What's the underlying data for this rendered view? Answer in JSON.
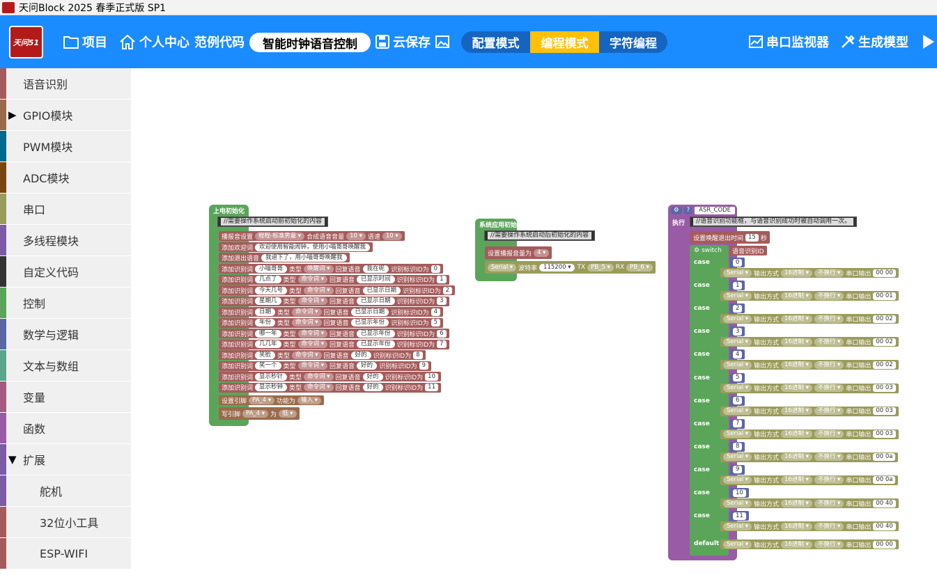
{
  "window_title": "天问Block 2025 春季正式版 SP1",
  "toolbar": {
    "logo_text": "天问51",
    "project": "项目",
    "personal_center": "个人中心",
    "examples": "范例代码",
    "project_name": "智能时钟语音控制",
    "cloud_save": "云保存",
    "modes": [
      "配置模式",
      "编程模式",
      "字符编程"
    ],
    "active_mode": "编程模式",
    "serial_monitor": "串口监视器",
    "build_model": "生成模型"
  },
  "sidebar": {
    "items": [
      {
        "label": "语音识别",
        "color": "#a55b5b"
      },
      {
        "label": "GPIO模块",
        "color": "#9a6b4b",
        "arrow": "▶"
      },
      {
        "label": "PWM模块",
        "color": "#006a8e"
      },
      {
        "label": "ADC模块",
        "color": "#7a4510"
      },
      {
        "label": "串口",
        "color": "#9b9b5b"
      },
      {
        "label": "多线程模块",
        "color": "#7b5ba5"
      },
      {
        "label": "自定义代码",
        "color": "#333333"
      },
      {
        "label": "控制",
        "color": "#5ba55b"
      },
      {
        "label": "数学与逻辑",
        "color": "#5b67a5"
      },
      {
        "label": "文本与数组",
        "color": "#5ba58c"
      },
      {
        "label": "变量",
        "color": "#a55b80"
      },
      {
        "label": "函数",
        "color": "#995ba5"
      },
      {
        "label": "扩展",
        "color": "#7b5ba5",
        "arrow": "▼"
      },
      {
        "label": "舵机",
        "color": "#7b5ba5",
        "sub": true
      },
      {
        "label": "32位小工具",
        "color": "#a55b5b",
        "sub": true
      },
      {
        "label": "ESP-WIFI",
        "color": "#a55b5b",
        "sub": true
      }
    ]
  },
  "colors": {
    "toolbar": "#1a8cff",
    "active_mode": "#ffc107",
    "asr_block": "#a55b5b",
    "control": "#5ba55b",
    "serial": "#9b9b5b",
    "function": "#995ba5"
  },
  "block1": {
    "header": "上电初始化",
    "comment": "//需要操作系统启动前初始化的内容",
    "setup": {
      "label": "播报音设置",
      "voice": "程程-标准男童",
      "vol_label": "合成语音音量",
      "vol": "10",
      "speed_label": "语速",
      "speed": "10"
    },
    "welcome": {
      "label": "添加欢迎词",
      "text": "欢迎使用智能闹钟，使用小喵哥哥唤醒我"
    },
    "exit": {
      "label": "添加退出语音",
      "text": "我退下了，用小喵哥哥唤醒我"
    },
    "rows": [
      {
        "word": "小喵哥哥",
        "type": "唤醒词",
        "reply": "我在呢",
        "id": "0"
      },
      {
        "word": "几点了",
        "type": "命令词",
        "reply": "已显示时间",
        "id": "1"
      },
      {
        "word": "今天几号",
        "type": "命令词",
        "reply": "已显示日期",
        "id": "2"
      },
      {
        "word": "星期几",
        "type": "命令词",
        "reply": "已显示日期",
        "id": "3"
      },
      {
        "word": "日期",
        "type": "命令词",
        "reply": "已显示日期",
        "id": "4"
      },
      {
        "word": "年份",
        "type": "命令词",
        "reply": "已显示年份",
        "id": "5"
      },
      {
        "word": "哪一年",
        "type": "命令词",
        "reply": "已显示年份",
        "id": "6"
      },
      {
        "word": "几几年",
        "type": "命令词",
        "reply": "已显示年份",
        "id": "7"
      },
      {
        "word": "笑脸",
        "type": "命令词",
        "reply": "好的",
        "id": "8"
      },
      {
        "word": "笑一个",
        "type": "命令词",
        "reply": "好的",
        "id": "9"
      },
      {
        "word": "显示秒针",
        "type": "命令词",
        "reply": "好的",
        "id": "10"
      },
      {
        "word": "显示秒钟",
        "type": "命令词",
        "reply": "好的",
        "id": "11"
      }
    ],
    "labels": {
      "add": "添加识别词",
      "type": "类型",
      "reply": "回复语音",
      "id": "识别标识ID为"
    },
    "pin": {
      "label": "设置引脚",
      "pin": "PA_4",
      "func": "功能为",
      "mode": "输入"
    },
    "write": {
      "label": "写引脚",
      "pin": "PA_4",
      "to": "为",
      "val": "低"
    }
  },
  "block2": {
    "header": "系统应用初始化",
    "comment": "//需要操作系统启动后初始化的内容",
    "volume": {
      "label": "设置播报音量为",
      "val": "4"
    },
    "serial": {
      "port": "Serial",
      "baud_label": "波特率",
      "baud": "115200",
      "tx": "TX",
      "tx_pin": "PB_5",
      "rx": "RX",
      "rx_pin": "PB_6"
    }
  },
  "block3": {
    "name": "ASR_CODE",
    "exec": "执行",
    "comment": "//语音识别功能框，与语音识别成功时被自动调用一次。",
    "timeout": {
      "label": "设置唤醒退出时间",
      "val": "15",
      "unit": "秒"
    },
    "switch": {
      "label": "switch",
      "var": "语音识别ID"
    },
    "case_label": "case",
    "default_label": "default",
    "serial_labels": {
      "port": "Serial",
      "out": "输出方式",
      "fmt": "16进制",
      "nl": "不换行",
      "data": "串口输出"
    },
    "cases": [
      {
        "v": "0",
        "out": "00 00"
      },
      {
        "v": "1",
        "out": "00 01"
      },
      {
        "v": "2",
        "out": "00 02"
      },
      {
        "v": "3",
        "out": "00 02"
      },
      {
        "v": "4",
        "out": "00 02"
      },
      {
        "v": "5",
        "out": "00 03"
      },
      {
        "v": "6",
        "out": "00 03"
      },
      {
        "v": "7",
        "out": "00 03"
      },
      {
        "v": "8",
        "out": "00 0a"
      },
      {
        "v": "9",
        "out": "00 0a"
      },
      {
        "v": "10",
        "out": "00 40"
      },
      {
        "v": "11",
        "out": "00 40"
      }
    ],
    "default_out": "00 00"
  }
}
